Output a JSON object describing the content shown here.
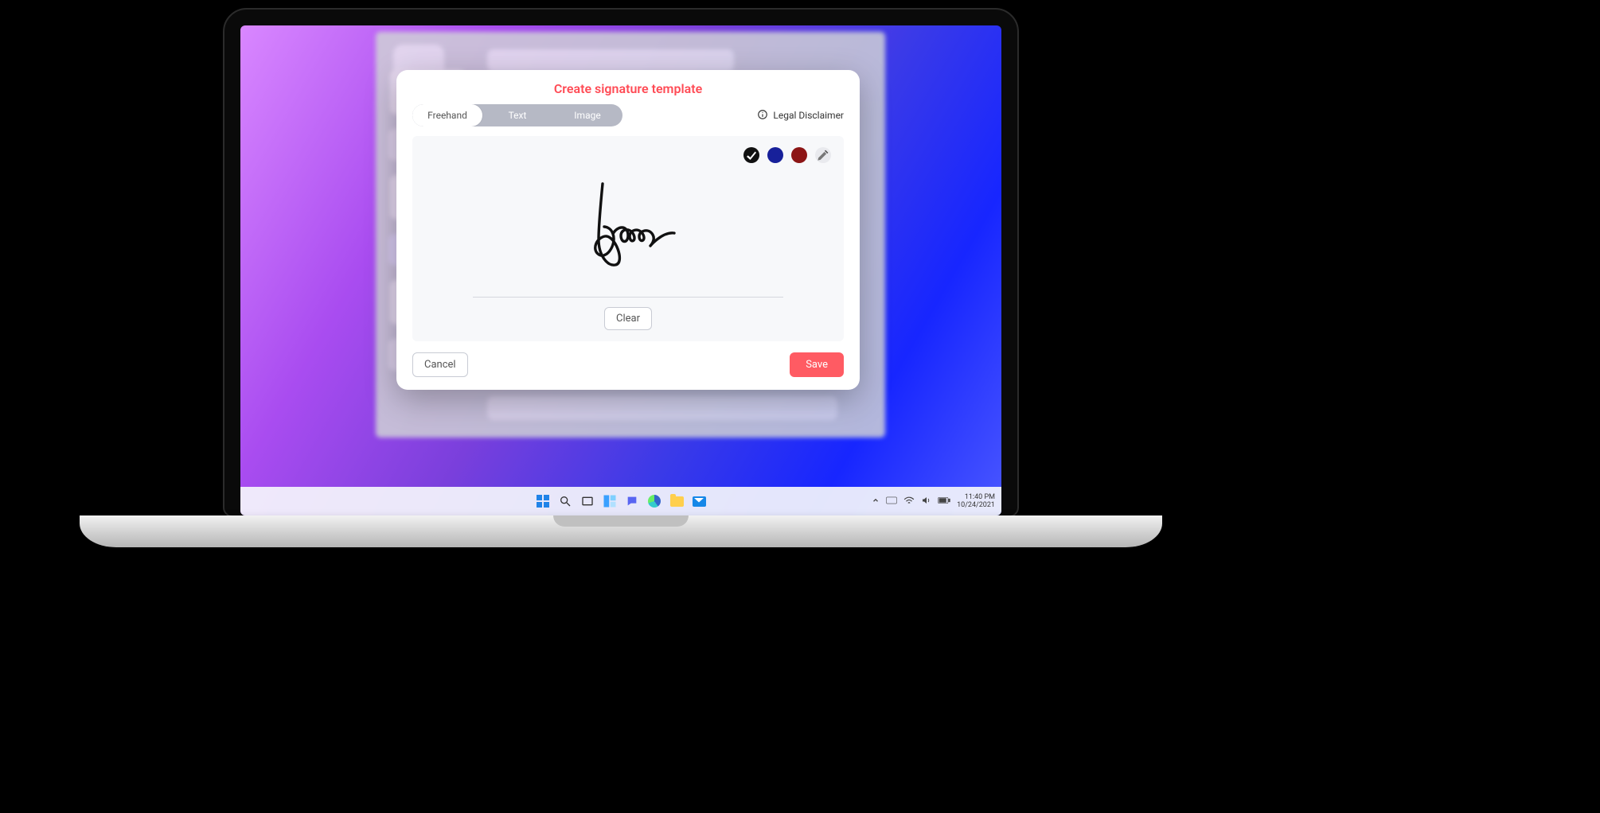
{
  "modal": {
    "title": "Create signature template",
    "tabs": {
      "freehand": "Freehand",
      "text": "Text",
      "image": "Image"
    },
    "legal": "Legal Disclaimer",
    "clear": "Clear",
    "cancel": "Cancel",
    "save": "Save",
    "colors": {
      "black": "#111111",
      "blue": "#17209a",
      "red": "#8c1515"
    }
  },
  "taskbar": {
    "time": "11:40 PM",
    "date": "10/24/2021"
  }
}
